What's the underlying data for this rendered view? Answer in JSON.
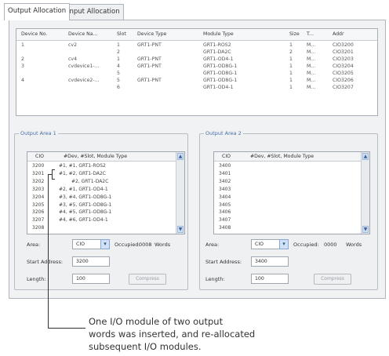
{
  "tabs": [
    {
      "label": "Output Allocation",
      "active": true
    },
    {
      "label": "Input Allocation",
      "active": false
    }
  ],
  "device_table": {
    "columns": [
      "Device No.",
      "Device Na...",
      "Slot",
      "Device Type",
      "Module Type",
      "Size",
      "T...",
      "Addr"
    ],
    "rows": [
      [
        "1",
        "cv2",
        "1",
        "GRT1-PNT",
        "GRT1-ROS2",
        "1",
        "M...",
        "CIO3200"
      ],
      [
        "",
        "",
        "2",
        "",
        "GRT1-DA2C",
        "2",
        "M...",
        "CIO3201"
      ],
      [
        "2",
        "cv4",
        "1",
        "GRT1-PNT",
        "GRT1-OD4-1",
        "1",
        "M...",
        "CIO3203"
      ],
      [
        "3",
        "cvdevice1-...",
        "4",
        "GRT1-PNT",
        "GRT1-OD8G-1",
        "1",
        "M...",
        "CIO3204"
      ],
      [
        "",
        "",
        "5",
        "",
        "GRT1-OD8G-1",
        "1",
        "M...",
        "CIO3205"
      ],
      [
        "4",
        "cvdevice2-...",
        "5",
        "GRT1-PNT",
        "GRT1-OD8G-1",
        "1",
        "M...",
        "CIO3206"
      ],
      [
        "",
        "",
        "6",
        "",
        "GRT1-OD4-1",
        "1",
        "M...",
        "CIO3207"
      ]
    ]
  },
  "output_area_1": {
    "title": "Output Area 1",
    "columns": [
      "CIO",
      "#Dev, #Slot, Module Type"
    ],
    "rows": [
      [
        "3200",
        "#1, #1, GRT1-ROS2"
      ],
      [
        "3201",
        "#1, #2, GRT1-DA2C"
      ],
      [
        "3202",
        "#2, GRT1-DA2C"
      ],
      [
        "3203",
        "#2, #1, GRT1-OD4-1"
      ],
      [
        "3204",
        "#3, #4, GRT1-OD8G-1"
      ],
      [
        "3205",
        "#3, #5, GRT1-OD8G-1"
      ],
      [
        "3206",
        "#4, #5, GRT1-OD8G-1"
      ],
      [
        "3207",
        "#4, #6, GRT1-OD4-1"
      ],
      [
        "3208",
        ""
      ]
    ],
    "area_label": "Area:",
    "area_value": "CIO",
    "occupied_label": "Occupied:",
    "occupied_value": "0008",
    "occupied_unit": "Words",
    "start_label": "Start Address:",
    "start_value": "3200",
    "length_label": "Length:",
    "length_value": "100",
    "button_label": "Compress"
  },
  "output_area_2": {
    "title": "Output Area 2",
    "columns": [
      "CIO",
      "#Dev, #Slot, Module Type"
    ],
    "rows": [
      [
        "3400",
        ""
      ],
      [
        "3401",
        ""
      ],
      [
        "3402",
        ""
      ],
      [
        "3403",
        ""
      ],
      [
        "3404",
        ""
      ],
      [
        "3405",
        ""
      ],
      [
        "3406",
        ""
      ],
      [
        "3407",
        ""
      ],
      [
        "3408",
        ""
      ]
    ],
    "area_label": "Area:",
    "area_value": "CIO",
    "occupied_label": "Occupied:",
    "occupied_value": "0000",
    "occupied_unit": "Words",
    "start_label": "Start Address:",
    "start_value": "3400",
    "length_label": "Length:",
    "length_value": "100",
    "button_label": "Compress"
  },
  "callout": {
    "line1": "One I/O module of two output",
    "line2": "words was inserted, and re-allocated",
    "line3": "subsequent I/O modules."
  },
  "colors": {
    "group_title": "#4a6fa8",
    "scroll_button": "#cfe0f7",
    "border": "#aeb4bb"
  }
}
